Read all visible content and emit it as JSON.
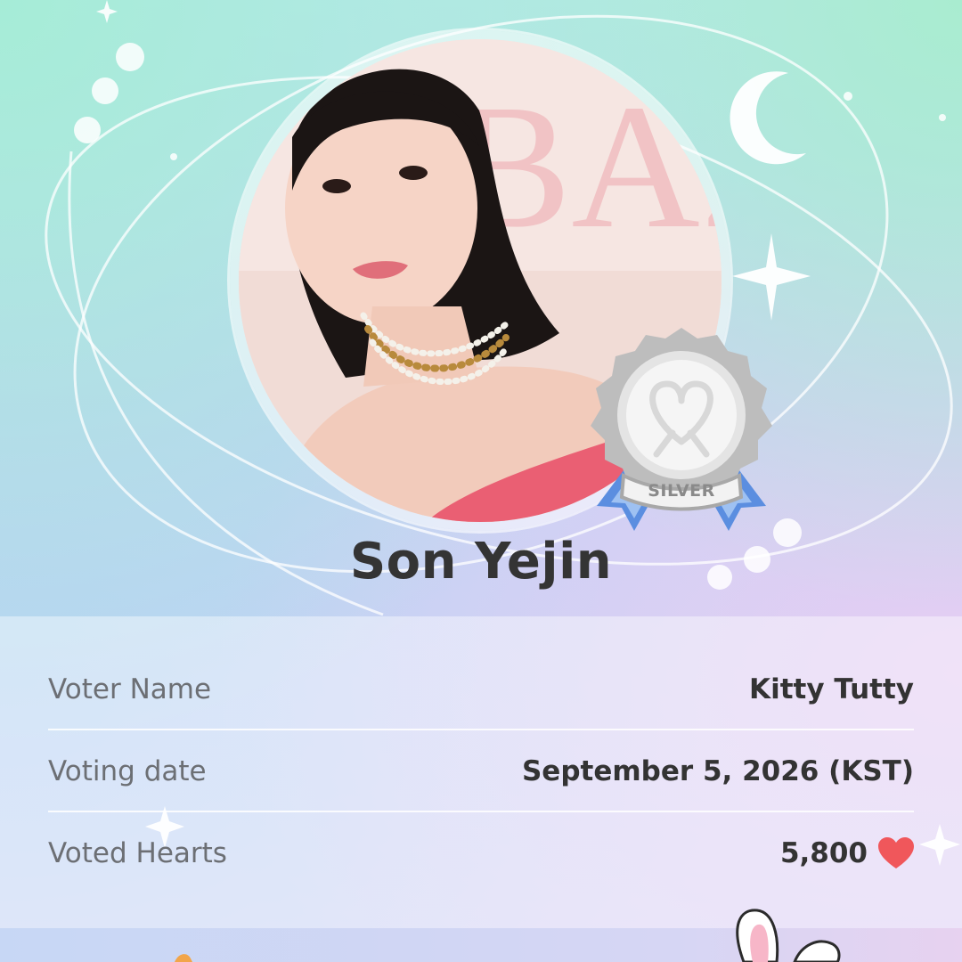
{
  "card": {
    "idol_name": "Son Yejin",
    "badge": {
      "tier": "SILVER",
      "color": "#c9c9c9",
      "ribbon_color": "#5b8ee0"
    },
    "photo_backdrop_text": "BAZ",
    "details": {
      "voter_name": {
        "label": "Voter Name",
        "value": "Kitty Tutty"
      },
      "voting_date": {
        "label": "Voting date",
        "value": "September 5, 2026 (KST)"
      },
      "voted_hearts": {
        "label": "Voted Hearts",
        "value": "5,800",
        "icon": "heart-icon",
        "icon_color": "#f0575b"
      }
    }
  },
  "decorations": [
    "moon-icon",
    "sparkle-icon",
    "orbit-rings",
    "bunny-icon"
  ]
}
